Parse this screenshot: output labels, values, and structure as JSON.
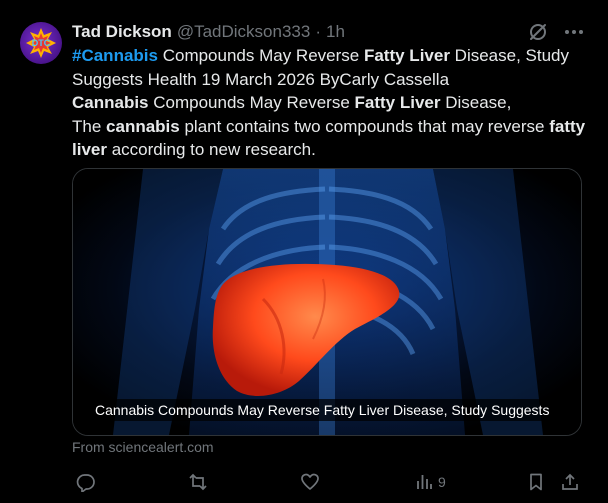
{
  "post": {
    "author_name": "Tad Dickson",
    "handle": "@TadDickson333",
    "separator": "·",
    "time": "1h",
    "text_parts": {
      "tag": "#Cannabis",
      "t1": " Compounds May Reverse ",
      "b1": "Fatty Liver",
      "t2": " Disease, Study Suggests Health 19 March 2026 ByCarly Cassella",
      "b2": "Cannabis",
      "t3": " Compounds May Reverse ",
      "b3": "Fatty Liver",
      "t4": " Disease,",
      "t5": "The ",
      "b4": "cannabis",
      "t6": " plant contains two compounds that may reverse ",
      "b5": "fatty liver",
      "t7": " according to new research."
    },
    "avatar_text": "DTC"
  },
  "card": {
    "caption": "Cannabis Compounds May Reverse Fatty Liver Disease, Study Suggests",
    "source": "From sciencealert.com"
  },
  "actions": {
    "reply_icon": "reply-icon",
    "repost_icon": "repost-icon",
    "like_icon": "like-icon",
    "views_icon": "views-icon",
    "views_count": "9",
    "bookmark_icon": "bookmark-icon",
    "share_icon": "share-icon"
  },
  "colors": {
    "background": "#000000",
    "text": "#e7e9ea",
    "muted": "#71767b",
    "accent": "#1d9bf0",
    "liver": "#ff4a1c"
  }
}
